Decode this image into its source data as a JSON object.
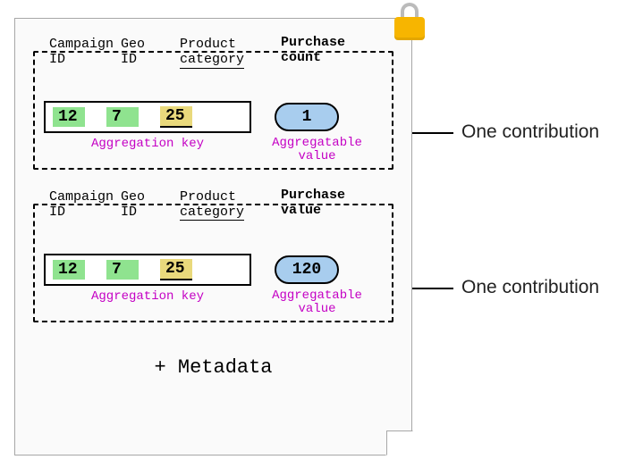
{
  "headers": {
    "campaign": "Campaign\nID",
    "geo": "Geo\nID",
    "product": "Product\ncategory",
    "metric_count": "Purchase count",
    "metric_value": "Purchase value"
  },
  "contribution1": {
    "campaign_id": "12",
    "geo_id": "7",
    "product_category": "25",
    "value": "1"
  },
  "contribution2": {
    "campaign_id": "12",
    "geo_id": "7",
    "product_category": "25",
    "value": "120"
  },
  "labels": {
    "aggregation_key": "Aggregation key",
    "aggregatable_value": "Aggregatable\nvalue",
    "one_contribution": "One contribution",
    "metadata": "+ Metadata"
  }
}
